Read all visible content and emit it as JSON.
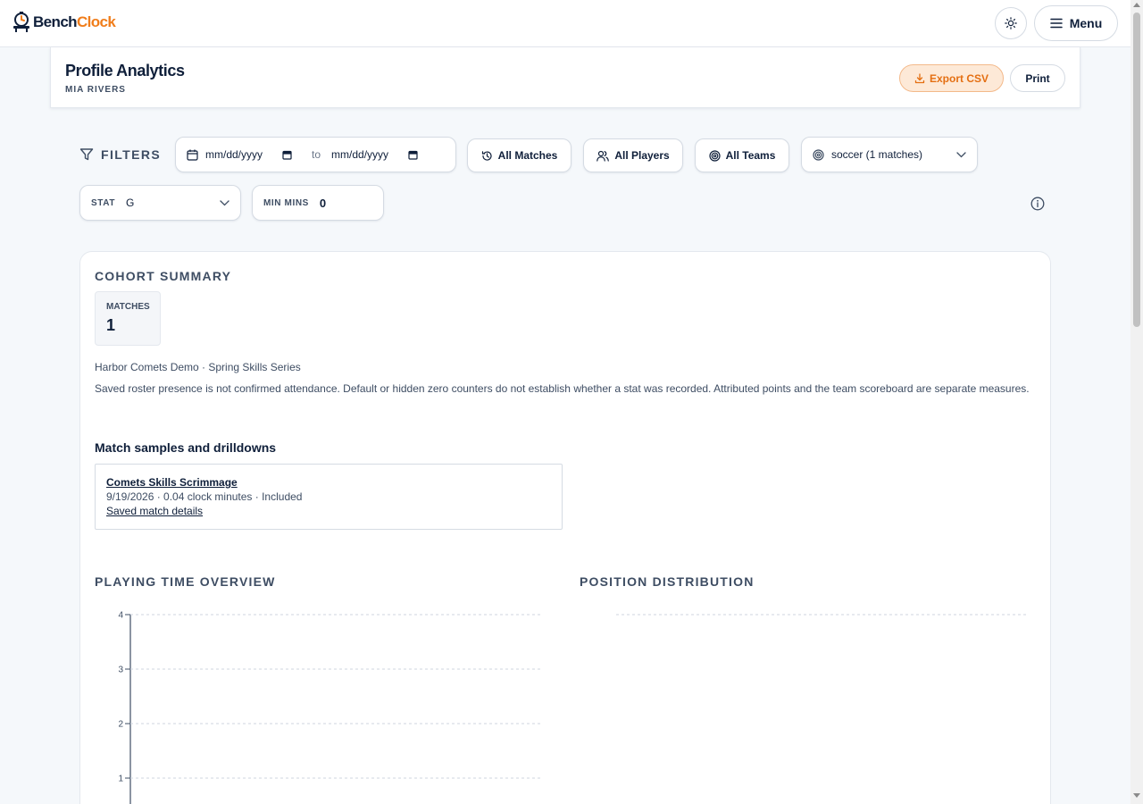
{
  "app": {
    "name_part1": "Bench",
    "name_part2": "Clock",
    "brand_color": "#f07d1b",
    "ink_color": "#0f1f3a"
  },
  "topbar": {
    "theme_icon": "sun-icon",
    "menu_label": "Menu"
  },
  "header": {
    "title": "Profile Analytics",
    "subtitle": "MIA RIVERS",
    "export_label": "Export CSV",
    "print_label": "Print"
  },
  "filters": {
    "label": "FILTERS",
    "date_from_placeholder": "mm/dd/yyyy",
    "date_to_label": "to",
    "date_to_placeholder": "mm/dd/yyyy",
    "matches_label": "All Matches",
    "players_label": "All Players",
    "teams_label": "All Teams",
    "sport_value": "soccer (1 matches)",
    "stat_label": "STAT",
    "stat_value": "G",
    "min_mins_label": "MIN MINS",
    "min_mins_value": "0"
  },
  "summary": {
    "title": "COHORT SUMMARY",
    "matches_label": "MATCHES",
    "matches_value": "1",
    "context": "Harbor Comets Demo · Spring Skills Series",
    "note": "Saved roster presence is not confirmed attendance. Default or hidden zero counters do not establish whether a stat was recorded. Attributed points and the team scoreboard are separate measures."
  },
  "samples": {
    "title": "Match samples and drilldowns",
    "items": [
      {
        "name": "Comets Skills Scrimmage",
        "meta": "9/19/2026 · 0.04 clock minutes · Included",
        "link": "Saved match details"
      }
    ]
  },
  "playing_time": {
    "title": "PLAYING TIME OVERVIEW"
  },
  "position": {
    "title": "POSITION DISTRIBUTION"
  },
  "chart_data": {
    "type": "bar",
    "title": "PLAYING TIME OVERVIEW",
    "categories": [],
    "values": [],
    "ylim": [
      0,
      4
    ],
    "yticks": [
      1,
      2,
      3,
      4
    ],
    "grid": true
  }
}
